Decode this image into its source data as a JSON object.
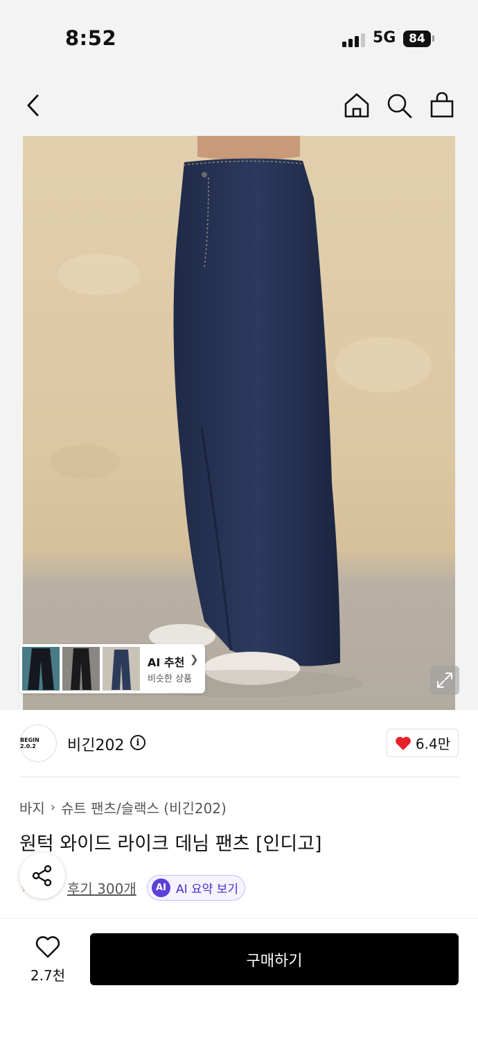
{
  "status_bar": {
    "time": "8:52",
    "network": "5G",
    "battery": "84"
  },
  "nav": {
    "back_icon": "chevron-left-icon",
    "home_icon": "home-icon",
    "search_icon": "search-icon",
    "bag_icon": "shopping-bag-icon"
  },
  "ai_recommend": {
    "title": "AI 추천",
    "subtitle": "비슷한 상품"
  },
  "brand": {
    "logo_text": "BEGIN 2.0.2",
    "name": "비긴202",
    "like_count": "6.4만"
  },
  "breadcrumb": {
    "category": "바지",
    "subcategory": "슈트 팬츠/슬랙스 (비긴202)"
  },
  "product": {
    "title": "원턱 와이드 라이크 데님 팬츠 [인디고]",
    "review_label": "후기 300개",
    "ai_summary_badge": "AI",
    "ai_summary_label": "AI 요약 보기"
  },
  "bottom_bar": {
    "wish_count": "2.7천",
    "buy_label": "구매하기"
  },
  "colors": {
    "accent_red": "#e8202a",
    "ai_purple": "#5b3fd9",
    "buy_button": "#000000"
  }
}
